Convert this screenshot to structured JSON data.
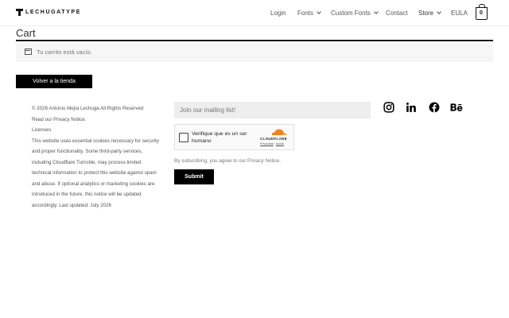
{
  "header": {
    "logo_text": "LECHUGATYPE",
    "nav": [
      {
        "label": "Login"
      },
      {
        "label": "Fonts"
      },
      {
        "label": "Custom Fonts"
      },
      {
        "label": "Contact"
      },
      {
        "label": "Store"
      },
      {
        "label": "EULA"
      }
    ],
    "cart_count": "0"
  },
  "main": {
    "title": "Cart",
    "empty_notice": "Tu carrito está vacío.",
    "back_button": "Volver a la tienda"
  },
  "footer": {
    "lines": [
      "© 2026 Antonio Mejía Lechuga All Rights Reserved",
      "Read our Privacy Notice.",
      "Licenses",
      "This website uses essential cookies necessary for security",
      "and proper functionality. Some third-party services,",
      "including Cloudflare Turnstile, may process limited",
      "technical information to protect this website against spam",
      "and abuse. If optional analytics or marketing cookies are",
      "introduced in the future, this notice will be updated",
      "accordingly. Last updated: July 2026"
    ],
    "mailing_placeholder": "Join our mailing list!",
    "turnstile": {
      "label": "Verifique que es un ser humano",
      "brand": "CLOUDFLARE",
      "privacy": "Privacidad",
      "separator": "·",
      "help": "Ayuda"
    },
    "subscribe_note": "By subscribing, you agree to our Privacy Notice.",
    "submit": "Submit",
    "social_icons": [
      "instagram-icon",
      "linkedin-icon",
      "facebook-icon",
      "behance-icon"
    ]
  },
  "colors": {
    "accent": "#000000",
    "notice_bg": "#f6f6f6",
    "input_bg": "#eeeeee",
    "cloudflare_orange": "#f48120"
  }
}
